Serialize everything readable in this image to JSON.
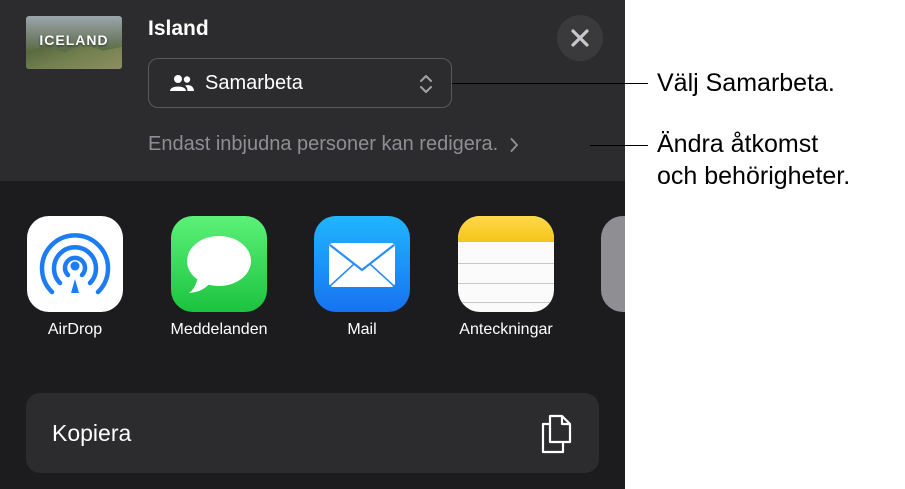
{
  "document": {
    "thumbnail_text": "ICELAND",
    "title": "Island"
  },
  "collaboration": {
    "selected": "Samarbeta",
    "access_text": "Endast inbjudna personer kan redigera."
  },
  "apps": [
    {
      "name": "AirDrop",
      "icon": "airdrop-icon"
    },
    {
      "name": "Meddelanden",
      "icon": "messages-icon"
    },
    {
      "name": "Mail",
      "icon": "mail-icon"
    },
    {
      "name": "Anteckningar",
      "icon": "notes-icon"
    }
  ],
  "copy": {
    "label": "Kopiera",
    "icon": "copy-icon"
  },
  "callouts": {
    "collaborate": "Välj Samarbeta.",
    "access_line1": "Ändra åtkomst",
    "access_line2": "och behörigheter."
  },
  "colors": {
    "sheet_background": "#1c1c1e",
    "header_background": "#2c2c2e",
    "secondary_text": "#8e8e93",
    "messages_green": "#1bc33f",
    "mail_blue": "#1673f0",
    "airdrop_blue": "#1e7cf2",
    "notes_yellow": "#f5c518"
  }
}
